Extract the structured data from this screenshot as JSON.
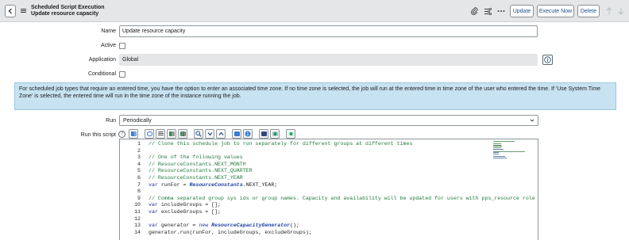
{
  "header": {
    "title": "Scheduled Script Execution",
    "subtitle": "Update resource capacity",
    "icons": [
      "paperclip-icon",
      "sliders-icon",
      "more-icon"
    ],
    "buttons": {
      "update": "Update",
      "execute_now": "Execute Now",
      "delete": "Delete"
    },
    "nav_icons": [
      "arrow-up-icon",
      "arrow-down-icon"
    ]
  },
  "form": {
    "name": {
      "label": "Name",
      "value": "Update resource capacity"
    },
    "active": {
      "label": "Active",
      "checked": false
    },
    "application": {
      "label": "Application",
      "value": "Global"
    },
    "conditional": {
      "label": "Conditional",
      "checked": false
    },
    "info": "For scheduled job types that require an entered time, you have the option to enter an associated time zone. If no time zone is selected, the job will run at the entered time in time zone of the user who entered the time. If 'Use System Time Zone' is selected, the entered time will run in the time zone of the instance running the job.",
    "run": {
      "label": "Run",
      "value": "Periodically"
    },
    "script": {
      "label": "Run this script",
      "help": "?"
    }
  },
  "editor": {
    "toolbar_icons": [
      "script-include-icon",
      "comment-icon",
      "format-icon",
      "replace-icon",
      "replace-all-icon",
      "search-icon",
      "find-next-icon",
      "find-prev-icon",
      "toggle-fullscreen-icon",
      "help-icon",
      "save-icon",
      "debug-icon",
      "script-debugger-icon"
    ],
    "lines": [
      {
        "n": "1",
        "parts": [
          {
            "c": "cm",
            "t": "// Clone this schedule job to run separately for different groups at different times"
          }
        ]
      },
      {
        "n": "2",
        "parts": []
      },
      {
        "n": "3",
        "parts": [
          {
            "c": "cm",
            "t": "// One of the following values"
          }
        ]
      },
      {
        "n": "4",
        "parts": [
          {
            "c": "cm",
            "t": "// ResourceConstants.NEXT_MONTH"
          }
        ]
      },
      {
        "n": "5",
        "parts": [
          {
            "c": "cm",
            "t": "// ResourceConstants.NEXT_QUARTER"
          }
        ]
      },
      {
        "n": "6",
        "parts": [
          {
            "c": "cm",
            "t": "// ResourceConstants.NEXT_YEAR"
          }
        ]
      },
      {
        "n": "7",
        "parts": [
          {
            "c": "kw",
            "t": "var"
          },
          {
            "c": "",
            "t": " runFor = "
          },
          {
            "c": "cls",
            "t": "ResourceConstants"
          },
          {
            "c": "",
            "t": ".NEXT_YEAR;"
          }
        ]
      },
      {
        "n": "8",
        "parts": []
      },
      {
        "n": "9",
        "parts": [
          {
            "c": "cm",
            "t": "// Comma separated group sys ids or group names. Capacity and availability will be updated for users with pps_resource role i"
          }
        ]
      },
      {
        "n": "10",
        "parts": [
          {
            "c": "kw",
            "t": "var"
          },
          {
            "c": "",
            "t": " includeGroups = [];"
          }
        ]
      },
      {
        "n": "11",
        "parts": [
          {
            "c": "kw",
            "t": "var"
          },
          {
            "c": "",
            "t": " excludeGroups = [];"
          }
        ]
      },
      {
        "n": "12",
        "parts": []
      },
      {
        "n": "13",
        "parts": [
          {
            "c": "kw",
            "t": "var"
          },
          {
            "c": "",
            "t": " generator = "
          },
          {
            "c": "kw",
            "t": "new"
          },
          {
            "c": "",
            "t": " "
          },
          {
            "c": "cls",
            "t": "ResourceCapacityGenerator"
          },
          {
            "c": "",
            "t": "();"
          }
        ]
      },
      {
        "n": "14",
        "parts": [
          {
            "c": "",
            "t": "generator.run(runFor, includeGroups, excludeGroups);"
          }
        ]
      }
    ]
  },
  "colors": {
    "header_bg": "#e4e6e7",
    "info_bg": "#c7e2f1",
    "button_text": "#1d4e89",
    "comment": "#1f7a3a",
    "keyword": "#2c2ca8"
  }
}
